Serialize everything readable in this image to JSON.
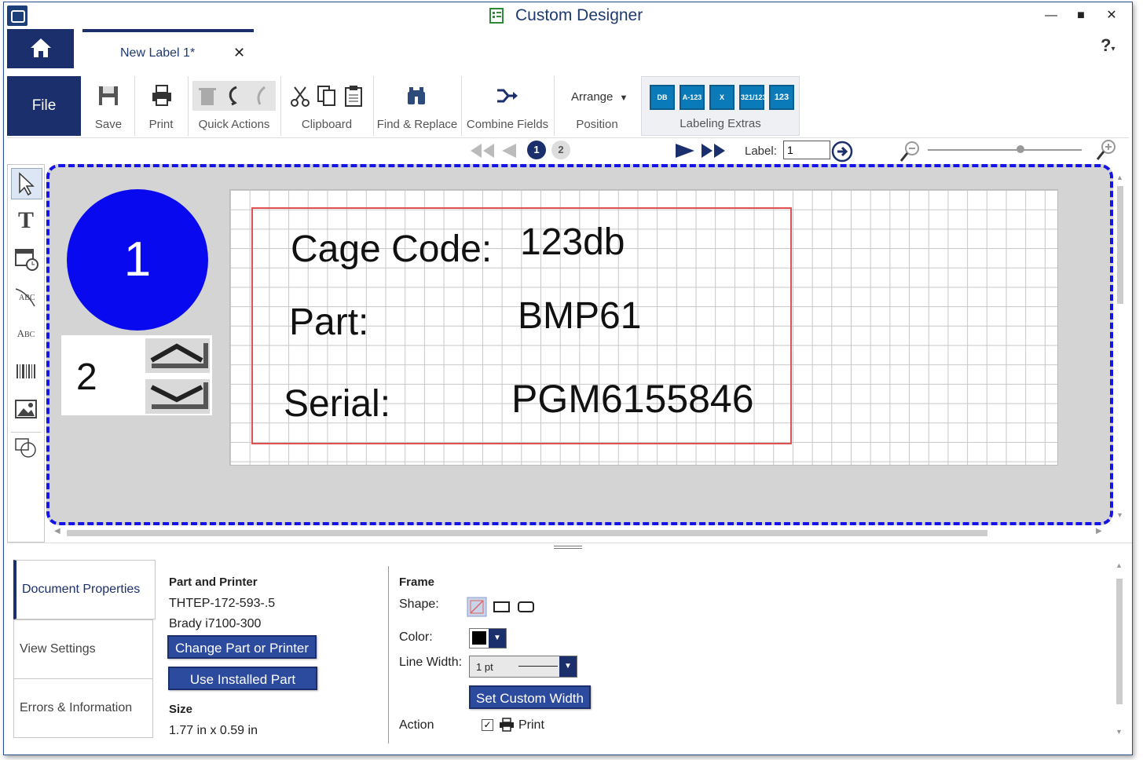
{
  "window": {
    "title": "Custom Designer"
  },
  "tabs": [
    {
      "label": "New Label 1*"
    }
  ],
  "help": {
    "label": "?"
  },
  "ribbon": {
    "file": "File",
    "groups": {
      "save": "Save",
      "print": "Print",
      "quick_actions": "Quick Actions",
      "clipboard": "Clipboard",
      "find_replace": "Find & Replace",
      "combine_fields": "Combine Fields",
      "arrange": "Arrange",
      "position": "Position",
      "labeling_extras": "Labeling Extras"
    },
    "extras_icons": [
      "database-icon",
      "A-123",
      "excel-icon",
      "321/123",
      "123"
    ]
  },
  "nav": {
    "pages": [
      "1",
      "2"
    ],
    "label_caption": "Label:",
    "label_value": "1"
  },
  "canvas": {
    "page_marker": "1",
    "stepper_value": "2",
    "label_text": {
      "cage_label": "Cage Code:",
      "cage_value": "123db",
      "part_label": "Part:",
      "part_value": "BMP61",
      "serial_label": "Serial:",
      "serial_value": "PGM6155846"
    }
  },
  "side_tabs": [
    "Document Properties",
    "View Settings",
    "Errors & Information"
  ],
  "properties": {
    "part_and_printer_heading": "Part and Printer",
    "part_number": "THTEP-172-593-.5",
    "printer": "Brady i7100-300",
    "change_button": "Change Part or Printer",
    "use_installed_button": "Use Installed Part",
    "size_heading": "Size",
    "size_value": "1.77 in x 0.59 in"
  },
  "frame": {
    "heading": "Frame",
    "shape_label": "Shape:",
    "color_label": "Color:",
    "line_width_label": "Line Width:",
    "line_width_value": "1 pt",
    "custom_width_button": "Set Custom Width",
    "action_label": "Action",
    "print_label": "Print",
    "print_checked": true
  },
  "colors": {
    "brand": "#1a2f6b",
    "accent_blue": "#0909f0",
    "selection_red": "#e05050"
  }
}
